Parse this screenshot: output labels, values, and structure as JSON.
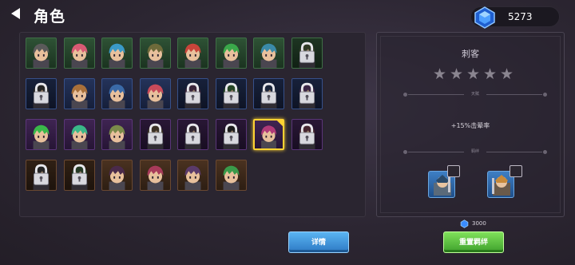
{
  "header": {
    "title": "角色",
    "currency": "5273",
    "gem_color": "#3a8cff"
  },
  "roster": {
    "cells": [
      {
        "rarity": "green",
        "state": "unlocked",
        "hair": "#5a5a5a"
      },
      {
        "rarity": "green",
        "state": "unlocked",
        "hair": "#d85a74"
      },
      {
        "rarity": "green",
        "state": "unlocked",
        "hair": "#3a9ac8"
      },
      {
        "rarity": "green",
        "state": "unlocked",
        "hair": "#6e6a3a"
      },
      {
        "rarity": "green",
        "state": "unlocked",
        "hair": "#c8443a"
      },
      {
        "rarity": "green",
        "state": "unlocked",
        "hair": "#3aa84a"
      },
      {
        "rarity": "green",
        "state": "unlocked",
        "hair": "#3a8aa8"
      },
      {
        "rarity": "green",
        "state": "locked",
        "hair": "#4a5a3a"
      },
      {
        "rarity": "blue",
        "state": "locked",
        "hair": "#3a3a3a"
      },
      {
        "rarity": "blue",
        "state": "unlocked",
        "hair": "#a8703a"
      },
      {
        "rarity": "blue",
        "state": "unlocked",
        "hair": "#3a6aa8"
      },
      {
        "rarity": "blue",
        "state": "unlocked",
        "hair": "#c84a5a"
      },
      {
        "rarity": "blue",
        "state": "locked",
        "hair": "#5a3a5a"
      },
      {
        "rarity": "blue",
        "state": "locked",
        "hair": "#3a6a3a"
      },
      {
        "rarity": "blue",
        "state": "locked",
        "hair": "#2a3a5a"
      },
      {
        "rarity": "blue",
        "state": "locked",
        "hair": "#5a3a6a"
      },
      {
        "rarity": "purple",
        "state": "unlocked",
        "hair": "#3ab84a"
      },
      {
        "rarity": "purple",
        "state": "unlocked",
        "hair": "#3ab888"
      },
      {
        "rarity": "purple",
        "state": "unlocked",
        "hair": "#7a8a4a"
      },
      {
        "rarity": "purple",
        "state": "locked",
        "hair": "#5a4a3a"
      },
      {
        "rarity": "purple",
        "state": "locked",
        "hair": "#4a3a4a"
      },
      {
        "rarity": "purple",
        "state": "locked",
        "hair": "#2a2a2a"
      },
      {
        "rarity": "purple",
        "state": "selected",
        "hair": "#b03a78"
      },
      {
        "rarity": "purple",
        "state": "locked",
        "hair": "#6a3a4a"
      },
      {
        "rarity": "orange",
        "state": "locked",
        "hair": "#3a3a3a"
      },
      {
        "rarity": "orange",
        "state": "locked",
        "hair": "#3a5a3a"
      },
      {
        "rarity": "orange",
        "state": "unlocked",
        "hair": "#4a2a4a"
      },
      {
        "rarity": "orange",
        "state": "unlocked",
        "hair": "#a83a5a"
      },
      {
        "rarity": "orange",
        "state": "unlocked",
        "hair": "#5a3a6a"
      },
      {
        "rarity": "orange",
        "state": "unlocked",
        "hair": "#3a9a4a"
      }
    ]
  },
  "info": {
    "class_name": "刺客",
    "star_count": 5,
    "talent_label": "天赋",
    "effect": "+15%击晕率",
    "bond_label": "羁绊",
    "bond_cost": "3000"
  },
  "buttons": {
    "details": "详情",
    "reset_bond": "重置羁绊"
  }
}
